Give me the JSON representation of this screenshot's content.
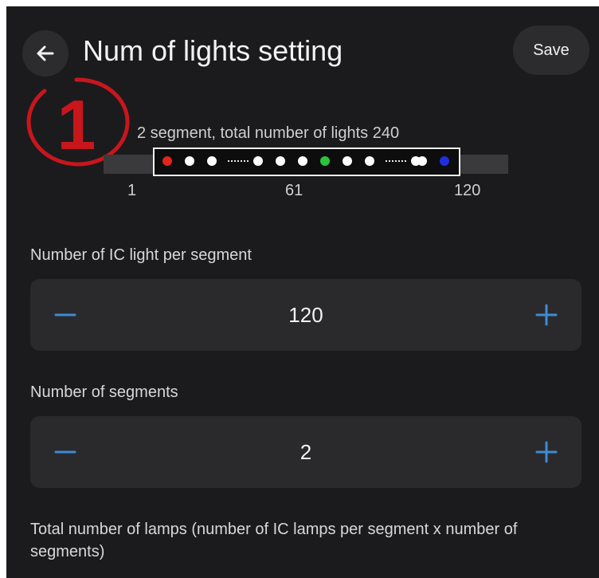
{
  "header": {
    "title": "Num of lights setting",
    "back_icon": "arrow-left-icon",
    "save_label": "Save"
  },
  "badge": {
    "number": "1",
    "color": "#c8161d"
  },
  "strip": {
    "caption": "2 segment,  total number of lights 240",
    "ticks": [
      "1",
      "61",
      "120"
    ],
    "led_colors": [
      "#e0251b",
      "#ffffff",
      "#ffffff",
      "#ffffff",
      "#ffffff",
      "#ffffff",
      "#2bc33c",
      "#ffffff",
      "#ffffff",
      "#ffffff",
      "#ffffff",
      "#1f2fe0"
    ]
  },
  "ic_per_segment": {
    "label": "Number of IC light per segment",
    "value": "120"
  },
  "segments": {
    "label": "Number of segments",
    "value": "2"
  },
  "total": {
    "label": "Total number of lamps (number of IC lamps per segment x number of segments)"
  },
  "colors": {
    "accent": "#3e8bd8",
    "background": "#1b1b1d",
    "card": "#2a2a2c"
  }
}
